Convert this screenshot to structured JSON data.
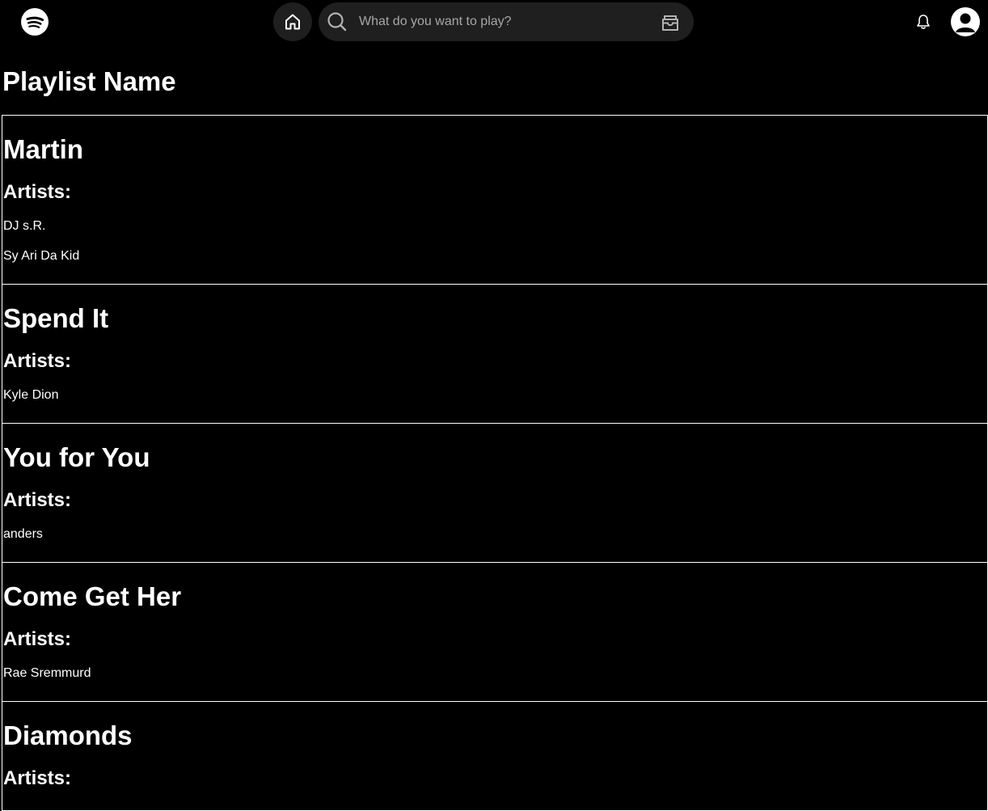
{
  "topbar": {
    "logo_icon": "spotify-logo-icon",
    "home_icon": "home-icon",
    "search": {
      "icon": "search-icon",
      "placeholder": "What do you want to play?",
      "value": "",
      "browse_icon": "browse-icon"
    },
    "notifications_icon": "bell-icon",
    "profile_icon": "user-avatar-icon"
  },
  "playlist": {
    "title": "Playlist Name",
    "artists_label": "Artists:",
    "tracks": [
      {
        "name": "Martin",
        "artists": [
          "DJ s.R.",
          "Sy Ari Da Kid"
        ]
      },
      {
        "name": "Spend It",
        "artists": [
          "Kyle Dion"
        ]
      },
      {
        "name": "You for You",
        "artists": [
          "anders"
        ]
      },
      {
        "name": "Come Get Her",
        "artists": [
          "Rae Sremmurd"
        ]
      },
      {
        "name": "Diamonds",
        "artists": []
      }
    ]
  },
  "colors": {
    "background": "#000000",
    "text": "#ffffff",
    "control_bg": "#1f1f1f",
    "placeholder": "#a7a7a7"
  }
}
